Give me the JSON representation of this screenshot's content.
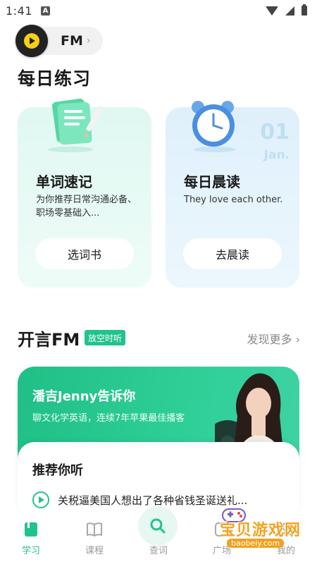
{
  "status_bar": {
    "time": "1:41",
    "notification_badge": "A"
  },
  "fm_pill": {
    "label": "FM",
    "chevron": "›",
    "accent": "#f7cf17"
  },
  "daily": {
    "title": "每日练习",
    "cards": [
      {
        "title": "单词速记",
        "desc": "为你推荐日常沟通必备、职场零基础入...",
        "button": "选词书",
        "icon": "notebook-pencil-icon"
      },
      {
        "title": "每日晨读",
        "desc": "They love each other.",
        "button": "去晨读",
        "icon": "alarm-clock-icon",
        "date_day": "01",
        "date_month": "Jan."
      }
    ]
  },
  "fm_section": {
    "title": "开言FM",
    "badge": "放空时听",
    "more": "发现更多 ›",
    "banner": {
      "title": "潘吉Jenny告诉你",
      "subtitle": "聊文化学英语，连续7年苹果最佳播客"
    },
    "recommend": {
      "title": "推荐你听",
      "item": "关税逼美国人想出了各种省钱圣诞送礼..."
    }
  },
  "tabbar": {
    "tabs": [
      {
        "label": "学习",
        "icon": "book-filled-icon",
        "active": true
      },
      {
        "label": "课程",
        "icon": "open-book-icon",
        "active": false
      },
      {
        "label": "查词",
        "icon": "search-icon",
        "active": false
      },
      {
        "label": "广场",
        "icon": "square-icon",
        "active": false
      },
      {
        "label": "我的",
        "icon": "profile-icon",
        "active": false
      }
    ]
  },
  "watermark": {
    "text": "宝贝游戏网",
    "url": "baobeiy.com"
  },
  "colors": {
    "brand_green": "#21c38c",
    "banner_green": "#2fcf98",
    "card_mint": "#e0f8f2",
    "card_blue": "#dff0fb"
  }
}
